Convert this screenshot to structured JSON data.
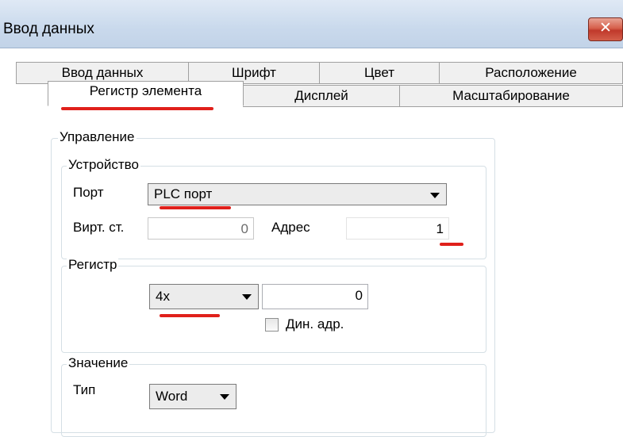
{
  "window": {
    "title": "Ввод данных",
    "close_label": "✕"
  },
  "tabs_row1": [
    "Ввод данных",
    "Шрифт",
    "Цвет",
    "Расположение"
  ],
  "tabs_row2": [
    "Регистр элемента",
    "Дисплей",
    "Масштабирование"
  ],
  "control": {
    "legend": "Управление",
    "device": {
      "legend": "Устройство",
      "port_label": "Порт",
      "port_value": "PLC порт",
      "virt_label": "Вирт. ст.",
      "virt_value": "0",
      "address_label": "Адрес",
      "address_value": "1"
    },
    "register": {
      "legend": "Регистр",
      "type_value": "4x",
      "number_value": "0",
      "dyn_addr_label": "Дин. адр."
    },
    "value": {
      "legend": "Значение",
      "type_label": "Тип",
      "type_value": "Word"
    }
  },
  "colors": {
    "highlight": "#e0201b",
    "close": "#c0392b"
  }
}
